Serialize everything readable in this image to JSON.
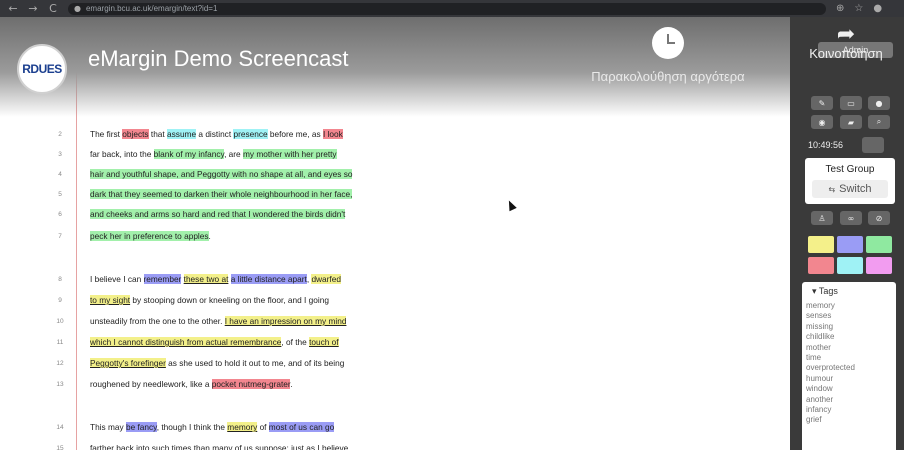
{
  "browser": {
    "url": "emargin.bcu.ac.uk/emargin/text?id=1",
    "back_icon": "←",
    "forward_icon": "→",
    "reload_icon": "C",
    "lock_icon": "lock-icon",
    "zoom_icon": "zoom-icon",
    "star_icon": "star-icon",
    "profile_icon": "profile-icon"
  },
  "video": {
    "logo_text": "RDUES",
    "title": "eMargin Demo Screencast",
    "watch_later": "Παρακολούθηση αργότερα",
    "share": "Κοινοποίηση"
  },
  "document": {
    "lines": [
      {
        "num": "2",
        "html": "The first <span class='r'>objects</span> that <span class='c'>assume</span> a distinct <span class='c'>presence</span> before me, as <span class='r'>I look</span>"
      },
      {
        "num": "3",
        "html": "far back, into the <span class='g'>blank of my infancy</span>, are <span class='g'>my mother with her pretty</span>"
      },
      {
        "num": "4",
        "html": "<span class='g'>hair and youthful shape, and Peggotty with no shape at all, and eyes so</span>"
      },
      {
        "num": "5",
        "html": "<span class='g'>dark that they seemed to darken their whole neighbourhood in her face,</span>"
      },
      {
        "num": "6",
        "html": "<span class='g'>and cheeks and arms so hard and red that I wondered the birds didn't</span>"
      },
      {
        "num": "7",
        "html": "<span class='g'>peck her in preference to apples</span>."
      },
      {
        "num": "8",
        "html": "I believe I can <span class='b'>remember</span> <span class='y u'>these two at</span> <span class='b'>a little distance apart</span>, <span class='y'>dwarfed</span>"
      },
      {
        "num": "9",
        "html": "<span class='y u'>to my sight</span> by stooping down or kneeling on the floor, and I going"
      },
      {
        "num": "10",
        "html": "unsteadily from the one to the other. <span class='y u'>I have an impression on my mind</span>"
      },
      {
        "num": "11",
        "html": "<span class='y u'>which I cannot distinguish from actual remembrance</span>, of the <span class='y u'>touch of</span>"
      },
      {
        "num": "12",
        "html": "<span class='y u'>Peggotty's forefinger</span> as she used to hold it out to me, and of its being"
      },
      {
        "num": "13",
        "html": "roughened by needlework, like a <span class='r'>pocket nutmeg-grater</span>."
      },
      {
        "num": "14",
        "html": "This may <span class='b'>be fancy</span>, though I think the <span class='y u'>memory</span> of <span class='b'>most of us can go</span>"
      },
      {
        "num": "15",
        "html": "farther back into such times than many of us suppose; just as I believe"
      }
    ]
  },
  "sidebar": {
    "admin_label": "Admin",
    "time": "10:49:56",
    "group_name": "Test Group",
    "switch_label": "Switch",
    "tags_header": "Tags",
    "tags": [
      "memory",
      "senses",
      "missing",
      "childlike",
      "mother",
      "time",
      "overprotected",
      "humour",
      "window",
      "another",
      "infancy",
      "grief"
    ],
    "swatch_colors": [
      "#f4f08a",
      "#9a9cf5",
      "#8fe9a0",
      "#f2868f",
      "#9ff2f5",
      "#f29cf0"
    ]
  }
}
